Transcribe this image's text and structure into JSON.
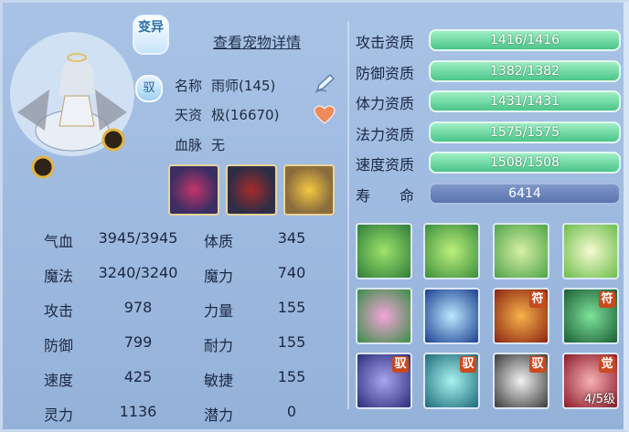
{
  "badge": {
    "mutate": "变异",
    "tame": "驭"
  },
  "view_details_link": "查看宠物详情",
  "info": {
    "name_label": "名称",
    "name_value": "雨师(145)",
    "talent_label": "天资",
    "talent_value": "极(16670)",
    "bloodline_label": "血脉",
    "bloodline_value": "无"
  },
  "stats": [
    {
      "label": "气血",
      "value": "3945/3945",
      "label2": "体质",
      "value2": "345"
    },
    {
      "label": "魔法",
      "value": "3240/3240",
      "label2": "魔力",
      "value2": "740"
    },
    {
      "label": "攻击",
      "value": "978",
      "label2": "力量",
      "value2": "155"
    },
    {
      "label": "防御",
      "value": "799",
      "label2": "耐力",
      "value2": "155"
    },
    {
      "label": "速度",
      "value": "425",
      "label2": "敏捷",
      "value2": "155"
    },
    {
      "label": "灵力",
      "value": "1136",
      "label2": "潜力",
      "value2": "0"
    }
  ],
  "aptitudes": [
    {
      "label": "攻击资质",
      "value": "1416/1416",
      "fill": 1.0
    },
    {
      "label": "防御资质",
      "value": "1382/1382",
      "fill": 1.0
    },
    {
      "label": "体力资质",
      "value": "1431/1431",
      "fill": 1.0
    },
    {
      "label": "法力资质",
      "value": "1575/1575",
      "fill": 1.0
    },
    {
      "label": "速度资质",
      "value": "1508/1508",
      "fill": 1.0
    },
    {
      "label": "寿　　命",
      "value": "6414"
    }
  ],
  "skill_tags": {
    "fu": "符",
    "yu": "驭",
    "jue": "觉"
  },
  "skill_level": "4/5级",
  "colors": {
    "bar_green": "#4cc48a",
    "tag_red": "#c84a1e"
  }
}
